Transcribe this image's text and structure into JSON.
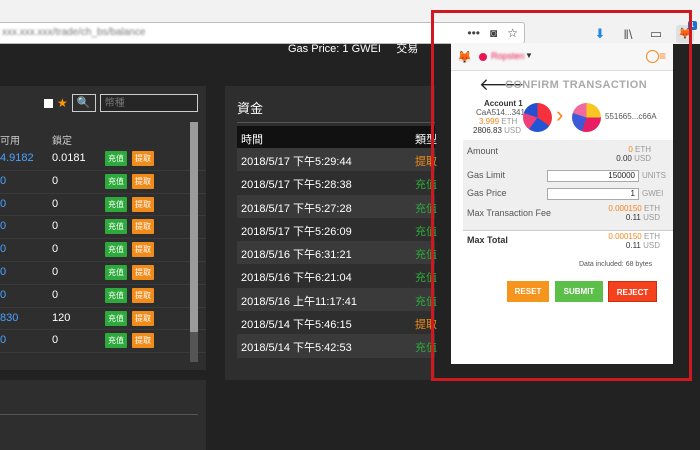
{
  "browser": {
    "url": "xxx.xxx.xxx/trade/ch_bs/balance",
    "toolbar_icons": [
      "more-icon",
      "pocket-icon",
      "bookmark-star-icon",
      "download-icon",
      "library-icon",
      "sidebar-icon",
      "metamask-icon",
      "menu-icon"
    ],
    "extension_badge": "1"
  },
  "header": {
    "gas_price": "Gas Price: 1 GWEI",
    "nav_item": "交易"
  },
  "balances": {
    "search_placeholder": "幣種",
    "columns": {
      "available": "可用",
      "locked": "鎖定"
    },
    "deposit_label": "充值",
    "withdraw_label": "提取",
    "rows": [
      {
        "available": "4.9182",
        "locked": "0.0181"
      },
      {
        "available": "0",
        "locked": "0"
      },
      {
        "available": "0",
        "locked": "0"
      },
      {
        "available": "0",
        "locked": "0"
      },
      {
        "available": "0",
        "locked": "0"
      },
      {
        "available": "0",
        "locked": "0"
      },
      {
        "available": "0",
        "locked": "0"
      },
      {
        "available": "830",
        "locked": "120"
      },
      {
        "available": "0",
        "locked": "0"
      }
    ]
  },
  "funds": {
    "title": "資金",
    "columns": {
      "time": "時間",
      "type": "類型"
    },
    "rows": [
      {
        "time": "2018/5/17 下午5:29:44",
        "type": "提取",
        "color": "#f08c1c"
      },
      {
        "time": "2018/5/17 下午5:28:38",
        "type": "充值",
        "color": "#2daa3b"
      },
      {
        "time": "2018/5/17 下午5:27:28",
        "type": "充值",
        "color": "#2daa3b"
      },
      {
        "time": "2018/5/17 下午5:26:09",
        "type": "充值",
        "color": "#2daa3b"
      },
      {
        "time": "2018/5/16 下午6:31:21",
        "type": "充值",
        "color": "#2daa3b"
      },
      {
        "time": "2018/5/16 下午6:21:04",
        "type": "充值",
        "color": "#2daa3b"
      },
      {
        "time": "2018/5/16 上午11:17:41",
        "type": "充值",
        "color": "#2daa3b"
      },
      {
        "time": "2018/5/14 下午5:46:15",
        "type": "提取",
        "color": "#f08c1c"
      },
      {
        "time": "2018/5/14 下午5:42:53",
        "type": "充值",
        "color": "#2daa3b"
      }
    ]
  },
  "metamask": {
    "network": "Ropsten",
    "title": "CONFIRM TRANSACTION",
    "from": {
      "name": "Account 1",
      "address": "CaA514...341c",
      "eth": "3.999",
      "eth_unit": "ETH",
      "usd": "2806.83",
      "usd_unit": "USD"
    },
    "to": {
      "address": "551665...c66A"
    },
    "amount": {
      "label": "Amount",
      "eth": "0",
      "eth_unit": "ETH",
      "usd": "0.00",
      "usd_unit": "USD"
    },
    "gas_limit": {
      "label": "Gas Limit",
      "value": "150000",
      "unit": "UNITS"
    },
    "gas_price": {
      "label": "Gas Price",
      "value": "1",
      "unit": "GWEI"
    },
    "max_fee": {
      "label": "Max Transaction Fee",
      "eth": "0.000150",
      "eth_unit": "ETH",
      "usd": "0.11",
      "usd_unit": "USD"
    },
    "max_total": {
      "label": "Max Total",
      "eth": "0.000150",
      "eth_unit": "ETH",
      "usd": "0.11",
      "usd_unit": "USD"
    },
    "data_note": "Data included: 68 bytes",
    "buttons": {
      "reset": "RESET",
      "submit": "SUBMIT",
      "reject": "REJECT"
    },
    "colors": {
      "accent": "#f6851b",
      "submit": "#5cbf4a",
      "reject": "#f4421f",
      "highlight_frame": "#d0181f"
    }
  }
}
